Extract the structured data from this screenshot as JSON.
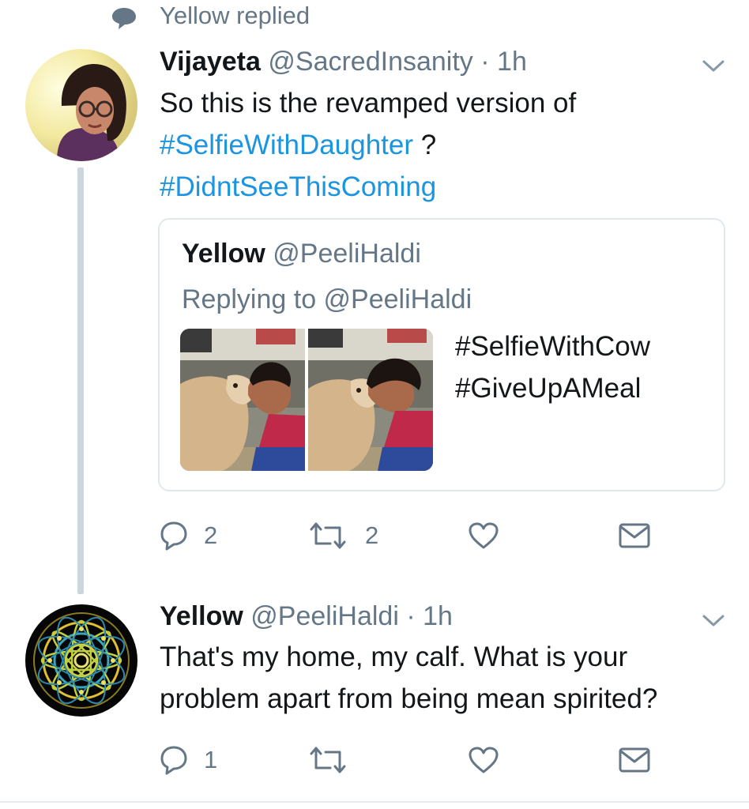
{
  "context": {
    "text": "Yellow replied",
    "icon": "speech-bubble-icon"
  },
  "tweet1": {
    "avatar": "avatar-photo-woman-glasses",
    "name": "Vijayeta",
    "handle": "@SacredInsanity",
    "dot": "·",
    "time": "1h",
    "text_line1": "So this is the revamped version of",
    "hashtag1": "#SelfieWithDaughter",
    "text_after_hashtag1": " ?",
    "hashtag2": "#DidntSeeThisComing",
    "quote": {
      "name": "Yellow",
      "handle": "@PeeliHaldi",
      "replying_prefix": "Replying to ",
      "replying_handle": "@PeeliHaldi",
      "text_line1": "#SelfieWithCow",
      "text_line2": "#GiveUpAMeal",
      "photos": [
        "woman-with-calf-photo",
        "woman-kissing-calf-photo"
      ]
    },
    "actions": {
      "reply_count": "2",
      "retweet_count": "2",
      "like_count": "",
      "dm_count": ""
    }
  },
  "tweet2": {
    "avatar": "mandala-avatar",
    "name": "Yellow",
    "handle": "@PeeliHaldi",
    "dot": "·",
    "time": "1h",
    "text_line1": "That's my home, my calf. What is your",
    "text_line2": "problem apart from being mean spirited?",
    "actions": {
      "reply_count": "1",
      "retweet_count": "",
      "like_count": "",
      "dm_count": ""
    }
  },
  "colors": {
    "text": "#14171a",
    "secondary": "#657786",
    "hashtag": "#1b95e0",
    "border": "#e1e8ed",
    "thread_line": "#ccd6dd"
  }
}
